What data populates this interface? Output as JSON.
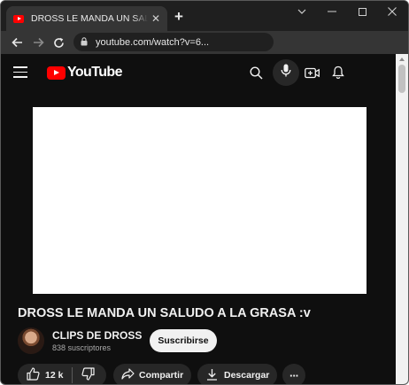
{
  "browser": {
    "tab_title": "DROSS LE MANDA UN SALUDO A LA GRASA :v",
    "tab_close": "✕",
    "new_tab": "+",
    "url": "youtube.com/watch?v=6..."
  },
  "youtube": {
    "logo_text": "YouTube",
    "header_icons": [
      "menu-icon",
      "search-icon",
      "mic-icon",
      "create-icon",
      "notifications-icon"
    ]
  },
  "video": {
    "title": "DROSS LE MANDA UN SALUDO A LA GRASA :v",
    "channel_name": "CLIPS DE DROSS",
    "subscribers": "838 suscriptores",
    "subscribe_label": "Suscribirse",
    "like_count": "12 k",
    "share_label": "Compartir",
    "download_label": "Descargar",
    "more_label": "···"
  },
  "colors": {
    "background": "#0f0f0f",
    "brand": "#ff0000",
    "chip": "#272727",
    "text": "#f1f1f1",
    "secondary_text": "#aaaaaa"
  }
}
